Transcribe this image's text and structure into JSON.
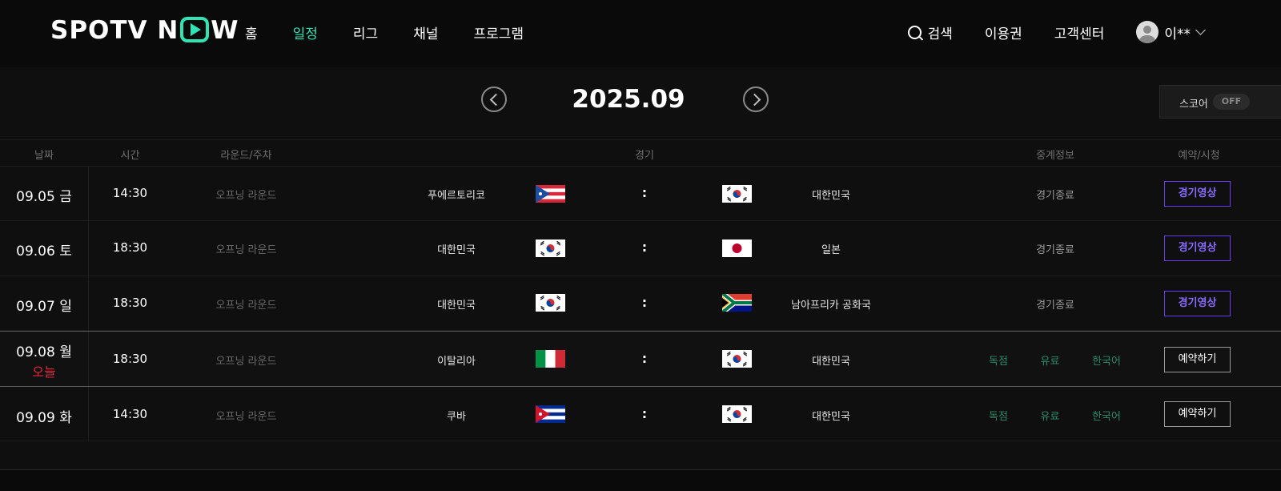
{
  "header": {
    "logo_left": "SPOTV N",
    "logo_right": "W",
    "nav": [
      "홈",
      "일정",
      "리그",
      "채널",
      "프로그램"
    ],
    "active_nav": "일정",
    "search_label": "검색",
    "pass_label": "이용권",
    "support_label": "고객센터",
    "user_label": "이**"
  },
  "month_bar": {
    "title": "2025.09",
    "score_label": "스코어",
    "score_state": "OFF"
  },
  "table": {
    "headers": {
      "date": "날짜",
      "time": "시간",
      "round": "라운드/주차",
      "match": "경기",
      "broadcast": "중계정보",
      "action": "예약/시청"
    },
    "rows": [
      {
        "date": "09.05 금",
        "time": "14:30",
        "round": "오프닝 라운드",
        "home": "푸에르토리코",
        "home_flag": "puerto-rico-flag",
        "away": "대한민국",
        "away_flag": "korea-flag",
        "score": ":",
        "status": "경기종료",
        "action": "경기영상"
      },
      {
        "date": "09.06 토",
        "time": "18:30",
        "round": "오프닝 라운드",
        "home": "대한민국",
        "home_flag": "korea-flag",
        "away": "일본",
        "away_flag": "japan-flag",
        "score": ":",
        "status": "경기종료",
        "action": "경기영상"
      },
      {
        "date": "09.07 일",
        "time": "18:30",
        "round": "오프닝 라운드",
        "home": "대한민국",
        "home_flag": "korea-flag",
        "away": "남아프리카 공화국",
        "away_flag": "south-africa-flag",
        "score": ":",
        "status": "경기종료",
        "action": "경기영상"
      },
      {
        "date": "09.08 월",
        "today": "오늘",
        "time": "18:30",
        "round": "오프닝 라운드",
        "home": "이탈리아",
        "home_flag": "italy-flag",
        "away": "대한민국",
        "away_flag": "korea-flag",
        "score": ":",
        "tags": [
          "독점",
          "유료",
          "한국어"
        ],
        "action": "예약하기"
      },
      {
        "date": "09.09 화",
        "time": "14:30",
        "round": "오프닝 라운드",
        "home": "쿠바",
        "home_flag": "cuba-flag",
        "away": "대한민국",
        "away_flag": "korea-flag",
        "score": ":",
        "tags": [
          "독점",
          "유료",
          "한국어"
        ],
        "action": "예약하기"
      }
    ]
  },
  "colors": {
    "accent": "#2fe3b5",
    "video_button": "#6a3df5",
    "today": "#e0283e",
    "tag": "#2b8a67"
  }
}
